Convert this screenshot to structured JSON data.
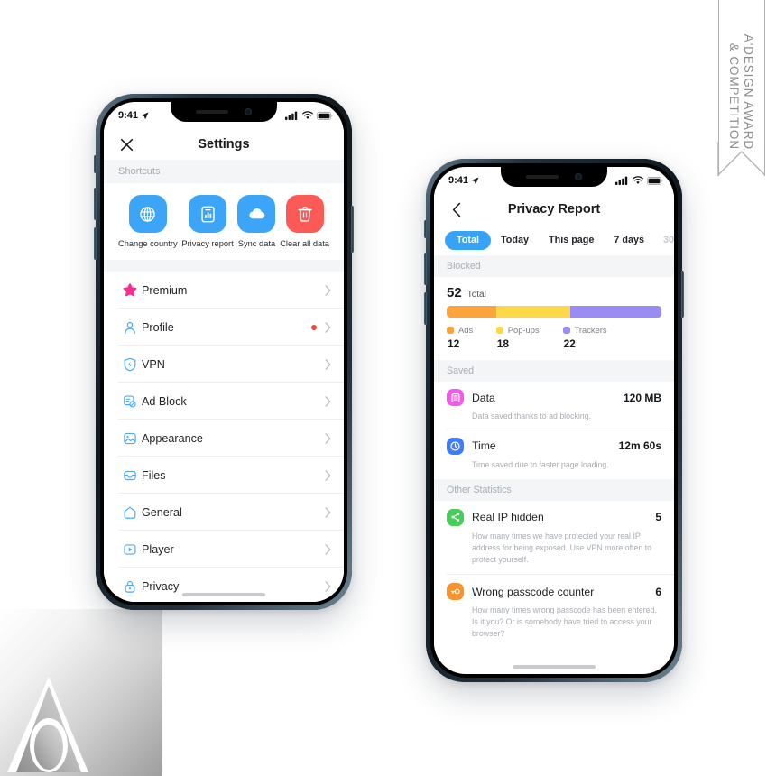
{
  "award_badge": {
    "line1": "A'DESIGN AWARD",
    "line2": "& COMPETITION"
  },
  "phone_settings": {
    "status_bar": {
      "time": "9:41",
      "location_icon": "location-arrow-icon",
      "signal_icon": "cellular-signal-icon",
      "wifi_icon": "wifi-icon",
      "battery_icon": "battery-icon"
    },
    "navbar": {
      "close_icon": "close-icon",
      "title": "Settings"
    },
    "shortcuts_header": "Shortcuts",
    "shortcuts": [
      {
        "icon": "globe-icon",
        "label": "Change\ncountry",
        "color": "#3CA5F7"
      },
      {
        "icon": "chart-document-icon",
        "label": "Privacy\nreport",
        "color": "#3CA5F7"
      },
      {
        "icon": "cloud-icon",
        "label": "Sync\ndata",
        "color": "#3CA5F7"
      },
      {
        "icon": "trash-icon",
        "label": "Clear\nall data",
        "color": "#FB5A56"
      }
    ],
    "items": [
      {
        "icon": "star-icon",
        "label": "Premium",
        "icon_color": "#F62E8E",
        "badge": false
      },
      {
        "icon": "person-icon",
        "label": "Profile",
        "icon_color": "#4EA8F7",
        "badge": true
      },
      {
        "icon": "shield-bolt-icon",
        "label": "VPN",
        "icon_color": "#4EA8F7",
        "badge": false
      },
      {
        "icon": "ad-block-icon",
        "label": "Ad Block",
        "icon_color": "#4EA8F7",
        "badge": false
      },
      {
        "icon": "image-icon",
        "label": "Appearance",
        "icon_color": "#4EA8F7",
        "badge": false
      },
      {
        "icon": "inbox-icon",
        "label": "Files",
        "icon_color": "#4EA8F7",
        "badge": false
      },
      {
        "icon": "home-icon",
        "label": "General",
        "icon_color": "#4EA8F7",
        "badge": false
      },
      {
        "icon": "play-box-icon",
        "label": "Player",
        "icon_color": "#4EA8F7",
        "badge": false
      },
      {
        "icon": "lock-icon",
        "label": "Privacy",
        "icon_color": "#4EA8F7",
        "badge": false
      }
    ]
  },
  "phone_report": {
    "status_bar": {
      "time": "9:41",
      "location_icon": "location-arrow-icon",
      "signal_icon": "cellular-signal-icon",
      "wifi_icon": "wifi-icon",
      "battery_icon": "battery-icon"
    },
    "navbar": {
      "back_icon": "chevron-left-icon",
      "title": "Privacy Report"
    },
    "tabs": [
      {
        "label": "Total",
        "active": true
      },
      {
        "label": "Today",
        "active": false
      },
      {
        "label": "This page",
        "active": false
      },
      {
        "label": "7 days",
        "active": false
      },
      {
        "label": "30",
        "active": false,
        "cut_off": true
      }
    ],
    "blocked_header": "Blocked",
    "saved_header": "Saved",
    "other_header": "Other Statistics",
    "saved": [
      {
        "icon": "data-stack-icon",
        "icon_color": "#F05CE8",
        "title": "Data",
        "value": "120 MB",
        "desc": "Data saved thanks to ad blocking."
      },
      {
        "icon": "clock-icon",
        "icon_color": "#3E7EF5",
        "title": "Time",
        "value": "12m 60s",
        "desc": "Time saved due to faster page loading."
      }
    ],
    "other_stats": [
      {
        "icon": "share-network-icon",
        "icon_color": "#45CE5A",
        "title": "Real IP hidden",
        "value": "5",
        "desc": "How many times we have protected your real IP address for being exposed. Use VPN more often to protect yourself."
      },
      {
        "icon": "key-icon",
        "icon_color": "#F7922E",
        "title": "Wrong passcode counter",
        "value": "6",
        "desc": "How many times wrong passcode has been entered. Is it you? Or is somebody have tried to access your browser?"
      }
    ]
  },
  "chart_data": {
    "type": "bar",
    "subtype": "stacked-horizontal",
    "title": "Blocked",
    "total_value": 52,
    "total_label": "Total",
    "categories": [
      "Ads",
      "Pop-ups",
      "Trackers"
    ],
    "values": [
      12,
      18,
      22
    ],
    "colors": [
      "#FBA43C",
      "#FDD949",
      "#9B8BF4"
    ],
    "legend": "bottom",
    "grid": false,
    "xlabel": "",
    "ylabel": ""
  }
}
